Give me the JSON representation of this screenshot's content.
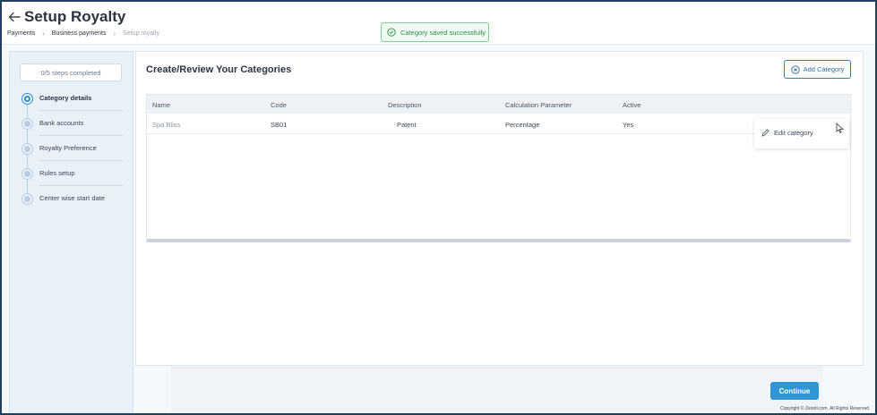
{
  "header": {
    "title": "Setup Royalty",
    "breadcrumb": [
      "Payments",
      "Business payments",
      "Setup royalty"
    ]
  },
  "toast": {
    "message": "Category saved successfully",
    "color": "#2f8a4d"
  },
  "sidebar": {
    "progress": "0/5 steps completed",
    "steps": [
      {
        "label": "Category details",
        "active": true
      },
      {
        "label": "Bank accounts",
        "active": false
      },
      {
        "label": "Royalty Preference",
        "active": false
      },
      {
        "label": "Rules setup",
        "active": false
      },
      {
        "label": "Center wise start date",
        "active": false
      }
    ]
  },
  "main": {
    "title": "Create/Review Your Categories",
    "add_button": "Add Category",
    "table": {
      "columns": [
        "Name",
        "Code",
        "Description",
        "Calculation Parameter",
        "Active"
      ],
      "rows": [
        [
          "Spa Bliss",
          "SB01",
          "Patent",
          "Percentage",
          "Yes"
        ]
      ]
    },
    "row_menu": {
      "edit_label": "Edit category"
    }
  },
  "footer": {
    "continue_label": "Continue",
    "copyright": "Copyright © Zenoti.com. All Rights Reserved"
  },
  "colors": {
    "accent": "#2f95d3",
    "active_step": "#2d8fc8",
    "success": "#7ccf97"
  }
}
